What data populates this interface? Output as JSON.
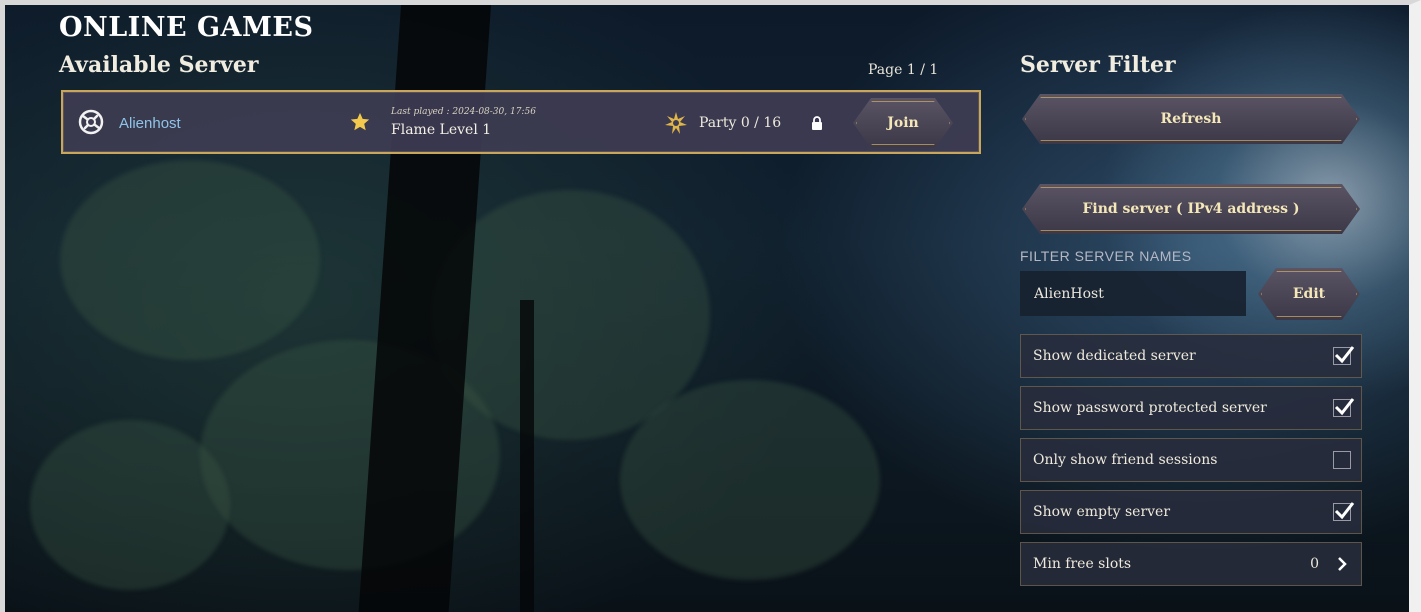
{
  "header": {
    "title": "ONLINE GAMES",
    "subtitle": "Available Server",
    "page_indicator": "Page 1 / 1"
  },
  "servers": [
    {
      "name": "Alienhost",
      "icon": "server-emblem-icon",
      "favorite_icon": "star-icon",
      "last_played_label": "Last played : 2024-08-30, 17:56",
      "world_name": "Flame Level 1",
      "party_icon": "party-emblem-icon",
      "party": "Party 0 / 16",
      "locked": true,
      "join_label": "Join"
    }
  ],
  "filter": {
    "title": "Server Filter",
    "refresh_label": "Refresh",
    "find_label": "Find server ( IPv4 address )",
    "name_filter_label": "FILTER SERVER NAMES",
    "name_filter_value": "AlienHost",
    "edit_label": "Edit",
    "options": [
      {
        "label": "Show dedicated server",
        "checked": true
      },
      {
        "label": "Show password protected server",
        "checked": true
      },
      {
        "label": "Only show friend sessions",
        "checked": false
      },
      {
        "label": "Show empty server",
        "checked": true
      }
    ],
    "min_free_slots_label": "Min free slots",
    "min_free_slots_value": "0"
  },
  "colors": {
    "accent_gold": "#c9a65a",
    "server_name": "#8fc4e8",
    "button_text": "#f4e7b8"
  }
}
